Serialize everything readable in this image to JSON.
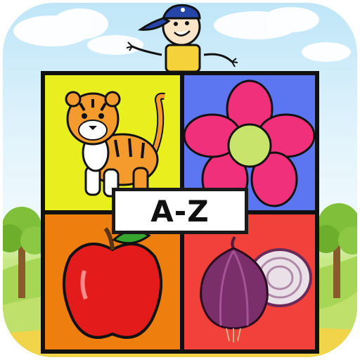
{
  "app": {
    "label": "A-Z",
    "tiles": [
      {
        "picture": "tiger-icon",
        "color": "#e9ee1e"
      },
      {
        "picture": "flower-icon",
        "color": "#5b76f0"
      },
      {
        "picture": "apple-icon",
        "color": "#ee7e0d"
      },
      {
        "picture": "onion-icon",
        "color": "#f2403a"
      }
    ],
    "colors": {
      "sky": "#bfe6f8",
      "grass": "#9fd14e",
      "border": "#111111",
      "label_bg": "#ffffff"
    }
  }
}
